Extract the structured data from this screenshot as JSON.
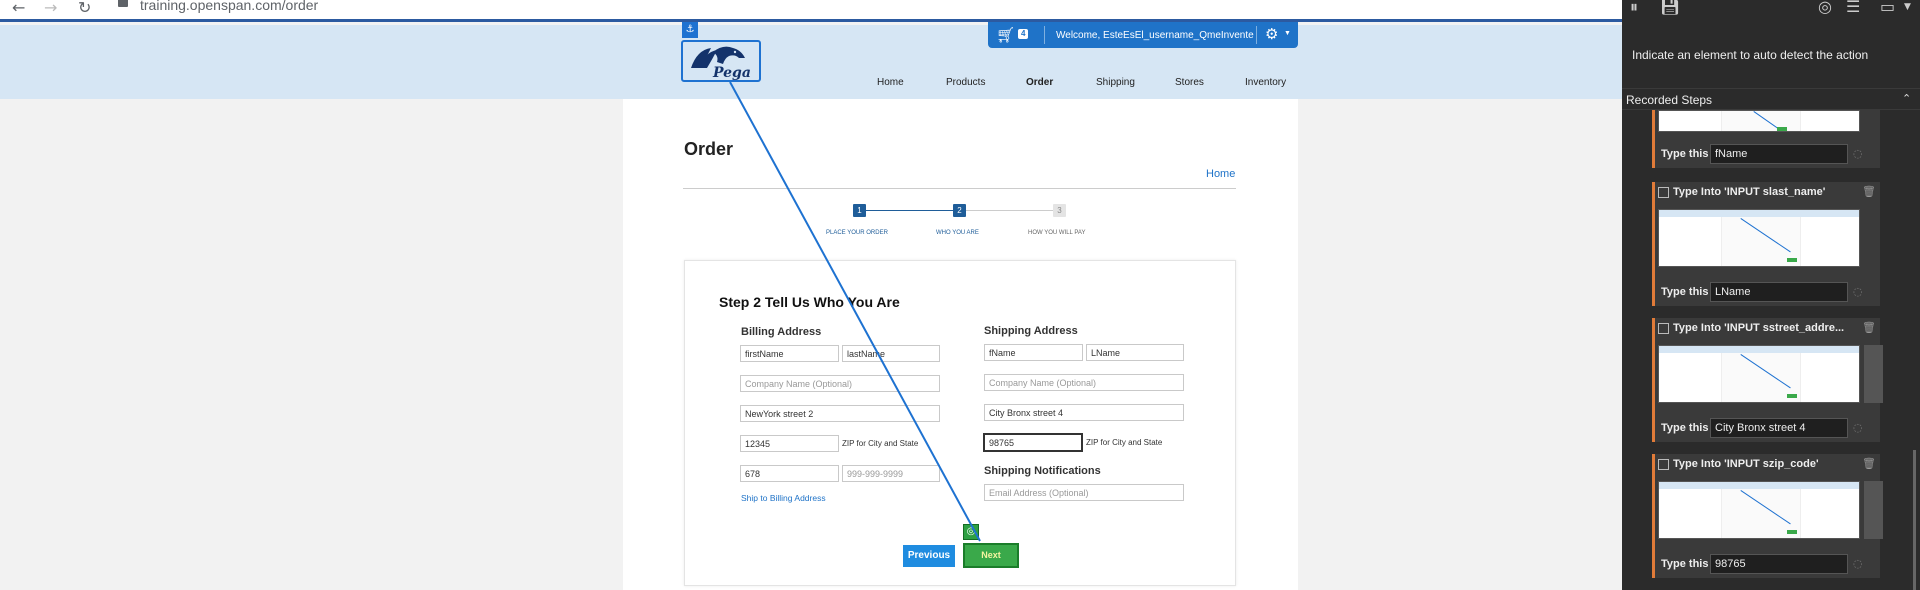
{
  "browser": {
    "back": "←",
    "forward": "→",
    "reload": "↻",
    "url": "training.openspan.com/order"
  },
  "header": {
    "cart_icon": "cart-icon",
    "cart_count": "4",
    "welcome": "Welcome, EsteEsEl_username_QmeInvente",
    "gear_icon": "gear-icon",
    "logo_text": "Pega",
    "anchor_glyph": "⚓",
    "menu": [
      "Home",
      "Products",
      "Order",
      "Shipping",
      "Stores",
      "Inventory"
    ]
  },
  "page": {
    "title": "Order",
    "home_link": "Home",
    "steps": [
      {
        "num": "1",
        "label": "PLACE YOUR ORDER",
        "state": "done"
      },
      {
        "num": "2",
        "label": "WHO YOU ARE",
        "state": "active"
      },
      {
        "num": "3",
        "label": "HOW YOU WILL PAY",
        "state": "pending"
      }
    ]
  },
  "form": {
    "step_title": "Step 2 Tell Us Who You Are",
    "billing": {
      "heading": "Billing Address",
      "first_name": "firstName",
      "last_name": "lastName",
      "company_placeholder": "Company Name (Optional)",
      "street": "NewYork street 2",
      "zip": "12345",
      "zip_hint": "ZIP for City and State",
      "area": "678",
      "phone": "999-999-9999",
      "ship_link": "Ship to Billing Address"
    },
    "shipping": {
      "heading": "Shipping Address",
      "first_name": "fName",
      "last_name": "LName",
      "company_placeholder": "Company Name (Optional)",
      "street": "City Bronx street 4",
      "zip": "98765",
      "zip_hint": "ZIP for City and State",
      "notifications_heading": "Shipping Notifications",
      "email_placeholder": "Email Address (Optional)"
    },
    "previous_label": "Previous",
    "next_label": "Next",
    "target_glyph": "◎"
  },
  "panel": {
    "prompt": "Indicate an element to auto detect the action",
    "recorded_title": "Recorded Steps",
    "caret": "⌃",
    "steps": [
      {
        "title": "",
        "type_label": "Type this",
        "value": "fName"
      },
      {
        "title": "Type Into 'INPUT slast_name'",
        "type_label": "Type this",
        "value": "LName"
      },
      {
        "title": "Type Into 'INPUT sstreet_addre...",
        "type_label": "Type this",
        "value": "City Bronx street 4"
      },
      {
        "title": "Type Into 'INPUT szip_code'",
        "type_label": "Type this",
        "value": "98765"
      }
    ]
  },
  "colors": {
    "accent": "#1f73c8",
    "header_bg": "#d6e6f4",
    "next_green": "#3aa94a",
    "panel_bg": "#2b2b2b",
    "card_stripe": "#e07b39"
  }
}
